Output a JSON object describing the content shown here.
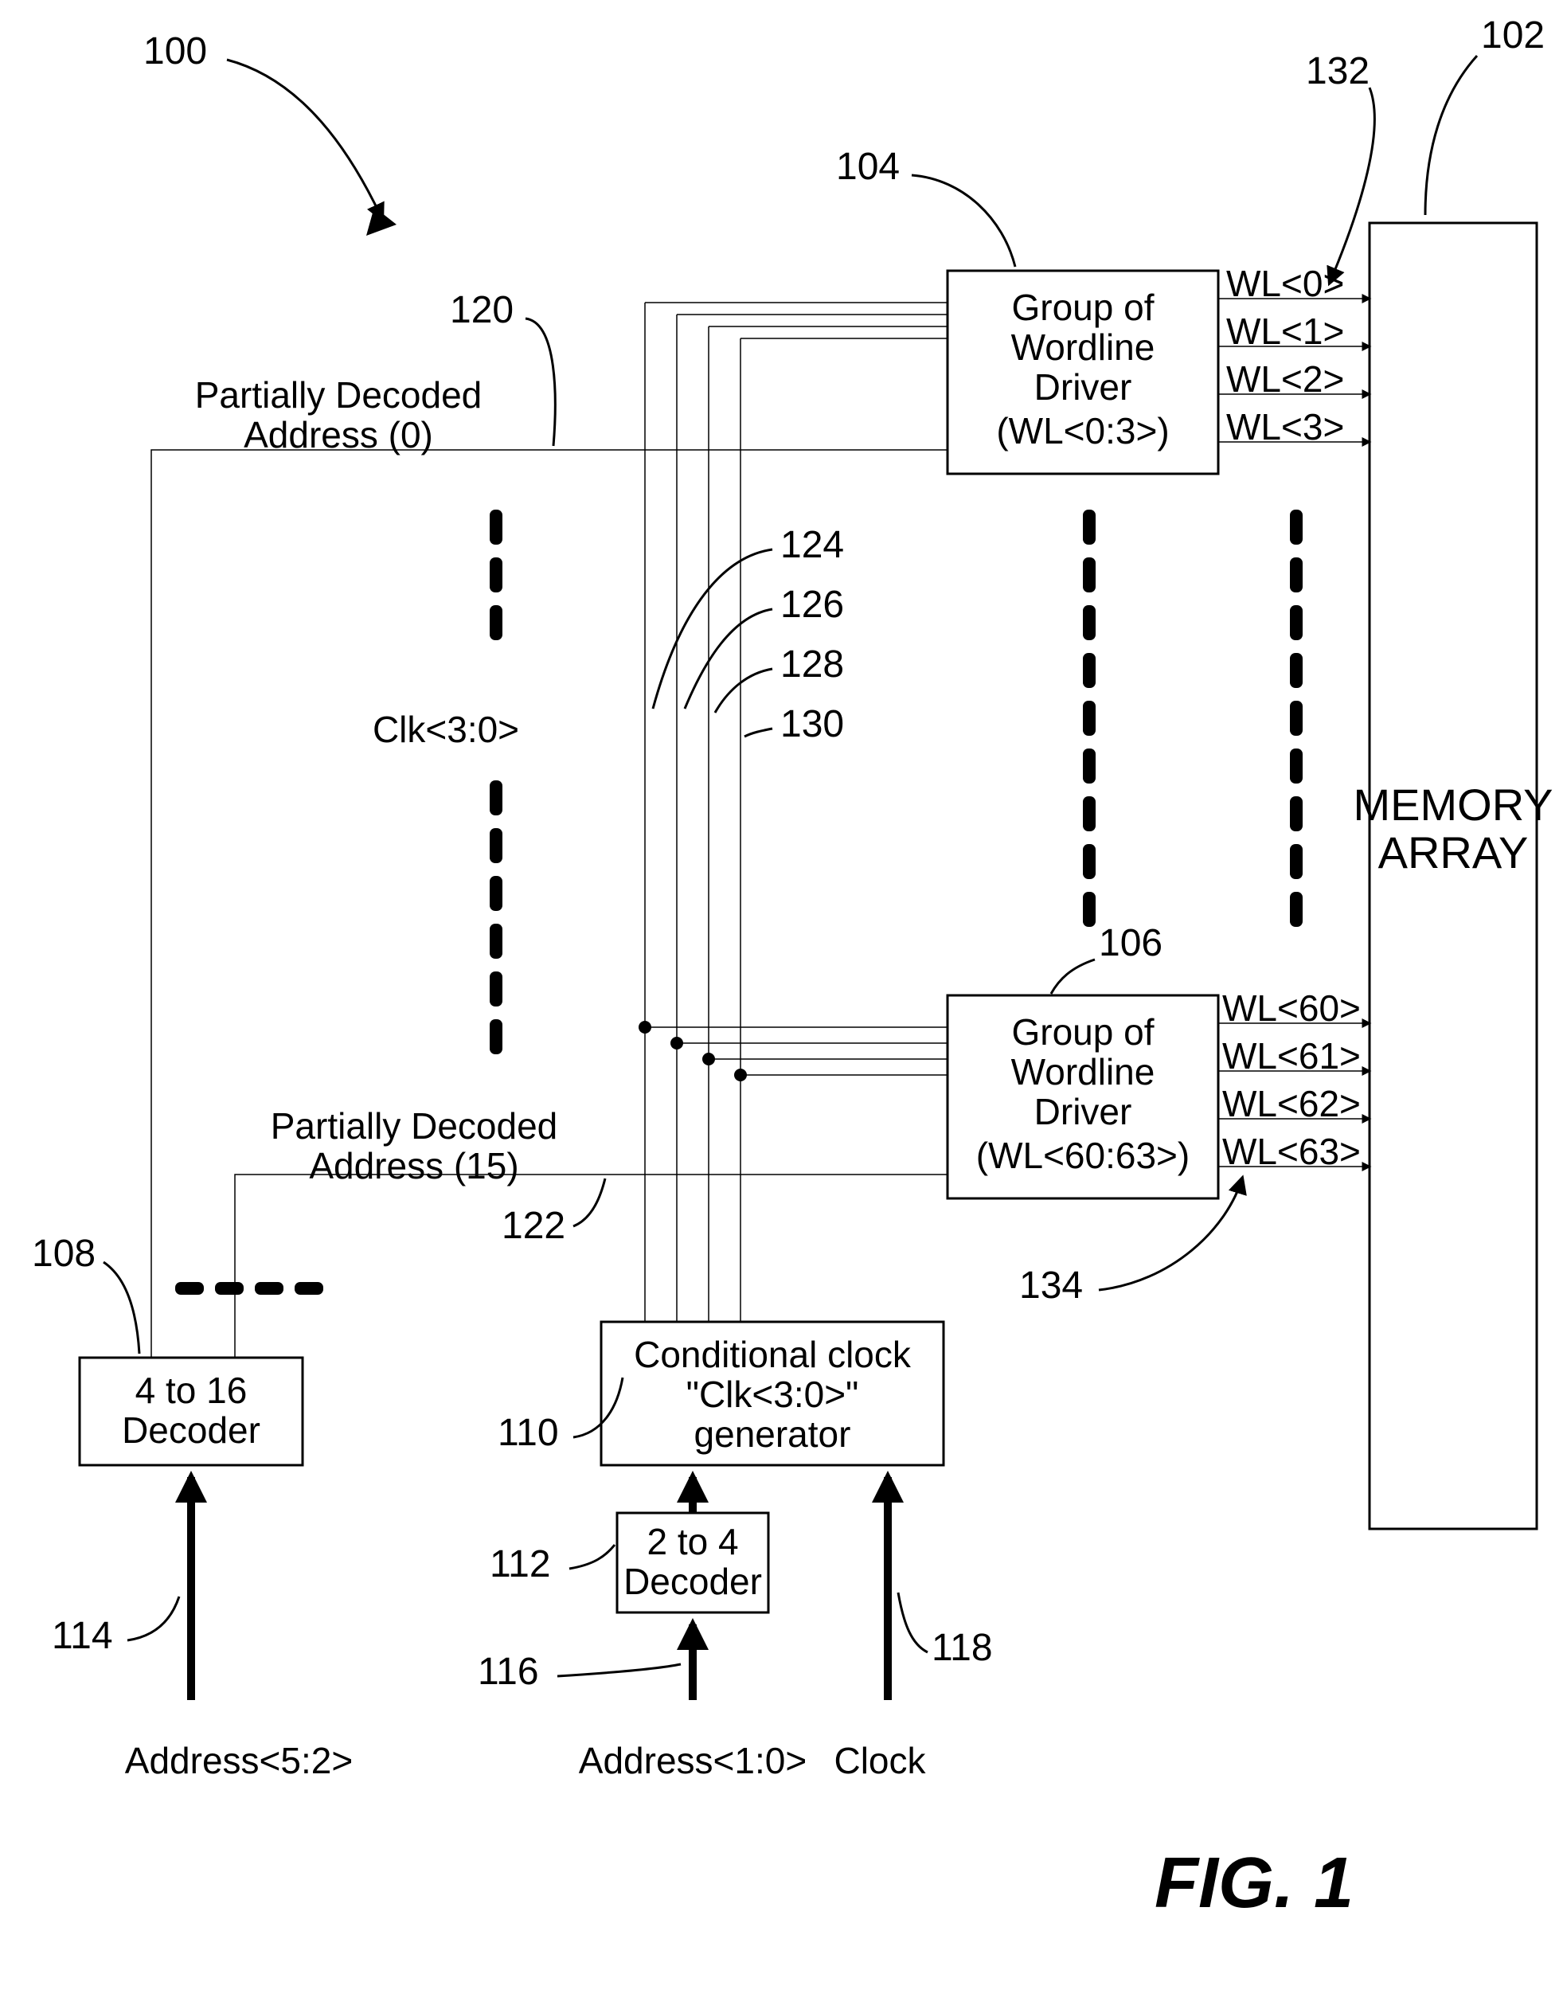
{
  "refs": {
    "r100": "100",
    "r102": "102",
    "r104": "104",
    "r106": "106",
    "r108": "108",
    "r110": "110",
    "r112": "112",
    "r114": "114",
    "r116": "116",
    "r118": "118",
    "r120": "120",
    "r122": "122",
    "r124": "124",
    "r126": "126",
    "r128": "128",
    "r130": "130",
    "r132": "132",
    "r134": "134"
  },
  "blocks": {
    "mem1": "MEMORY",
    "mem2": "ARRAY",
    "drvA1": "Group of",
    "drvA2": "Wordline",
    "drvA3": "Driver",
    "drvA4": "(WL<0:3>)",
    "drvB1": "Group of",
    "drvB2": "Wordline",
    "drvB3": "Driver",
    "drvB4": "(WL<60:63>)",
    "dec4_1": "4 to 16",
    "dec4_2": "Decoder",
    "ccg1": "Conditional clock",
    "ccg2": "\"Clk<3:0>\"",
    "ccg3": "generator",
    "dec2_1": "2 to 4",
    "dec2_2": "Decoder"
  },
  "text": {
    "pda0a": "Partially Decoded",
    "pda0b": "Address (0)",
    "pda15a": "Partially Decoded",
    "pda15b": "Address (15)",
    "clkbus": "Clk<3:0>",
    "a52": "Address<5:2>",
    "a10": "Address<1:0>",
    "clk": "Clock",
    "wl0": "WL<0>",
    "wl1": "WL<1>",
    "wl2": "WL<2>",
    "wl3": "WL<3>",
    "wl60": "WL<60>",
    "wl61": "WL<61>",
    "wl62": "WL<62>",
    "wl63": "WL<63>",
    "fig": "FIG. 1"
  }
}
